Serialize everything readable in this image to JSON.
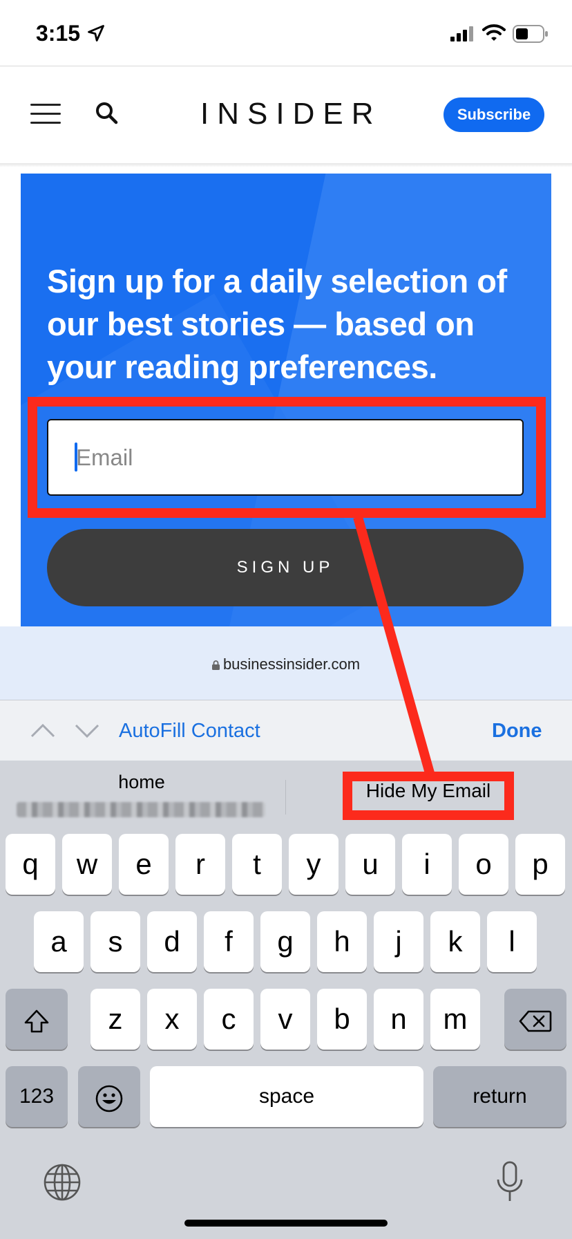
{
  "status_bar": {
    "time": "3:15"
  },
  "header": {
    "logo": "INSIDER",
    "subscribe_label": "Subscribe"
  },
  "hero": {
    "headline": "Sign up for a daily selection of our best stories — based on your reading preferences.",
    "email_placeholder": "Email",
    "signup_label": "SIGN UP"
  },
  "url_bar": {
    "domain": "businessinsider.com"
  },
  "toolbar": {
    "autofill_label": "AutoFill Contact",
    "done_label": "Done"
  },
  "suggestions": {
    "home_label": "home",
    "hide_my_email_label": "Hide My Email"
  },
  "keyboard": {
    "row1": [
      "q",
      "w",
      "e",
      "r",
      "t",
      "y",
      "u",
      "i",
      "o",
      "p"
    ],
    "row2": [
      "a",
      "s",
      "d",
      "f",
      "g",
      "h",
      "j",
      "k",
      "l"
    ],
    "row3": [
      "z",
      "x",
      "c",
      "v",
      "b",
      "n",
      "m"
    ],
    "numbers_label": "123",
    "space_label": "space",
    "return_label": "return"
  },
  "annotation_color": "#fc2a1c",
  "accent_color": "#106af0"
}
